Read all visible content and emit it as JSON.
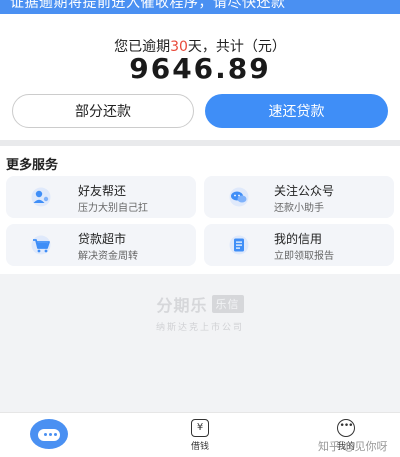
{
  "top_banner": {
    "text": "证据逾期将提前进入催收程序，请尽快还款"
  },
  "summary": {
    "overdue_prefix": "您已逾期",
    "overdue_days": "30",
    "overdue_suffix": "天，共计（元）",
    "amount": "9646.89",
    "partial_button": "部分还款",
    "fast_button": "速还贷款"
  },
  "services": {
    "title": "更多服务",
    "items": [
      {
        "title": "好友帮还",
        "subtitle": "压力大别自己扛",
        "icon": "friend-help-icon"
      },
      {
        "title": "关注公众号",
        "subtitle": "还款小助手",
        "icon": "wechat-icon"
      },
      {
        "title": "贷款超市",
        "subtitle": "解决资金周转",
        "icon": "cart-icon"
      },
      {
        "title": "我的信用",
        "subtitle": "立即领取报告",
        "icon": "credit-report-icon"
      }
    ]
  },
  "brand": {
    "name": "分期乐",
    "tag": "乐信",
    "subtitle": "纳斯达克上市公司"
  },
  "bottom_nav": {
    "borrow_label": "借钱",
    "mine_label": "我的"
  },
  "watermark": "知乎 @见你呀",
  "colors": {
    "accent": "#3f8ef7",
    "overdue_red": "#e84a3a",
    "tile_bg": "#f3f5f9"
  }
}
